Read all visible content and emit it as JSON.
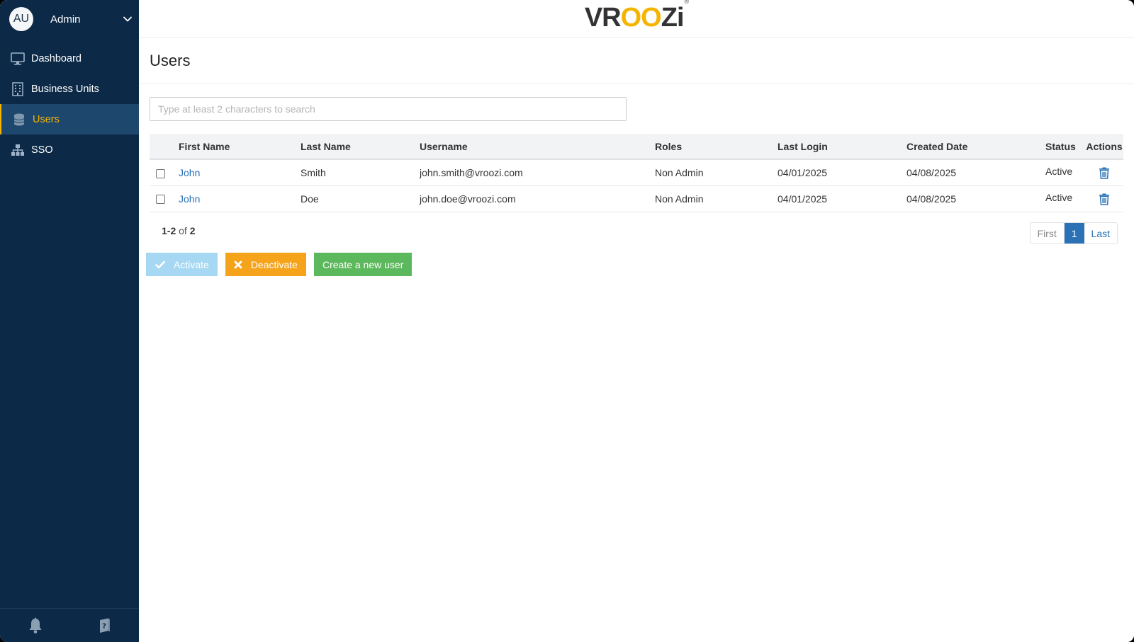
{
  "user": {
    "initials": "AU",
    "name": "Admin"
  },
  "nav": {
    "items": [
      {
        "label": "Dashboard",
        "icon": "monitor-icon"
      },
      {
        "label": "Business Units",
        "icon": "building-icon"
      },
      {
        "label": "Users",
        "icon": "database-icon",
        "active": true
      },
      {
        "label": "SSO",
        "icon": "sitemap-icon"
      }
    ]
  },
  "brand": {
    "logo_a": "VR",
    "logo_b": "OO",
    "logo_c": "Zi",
    "reg": "®"
  },
  "page": {
    "title": "Users"
  },
  "search": {
    "placeholder": "Type at least 2 characters to search"
  },
  "table": {
    "headers": {
      "first": "First Name",
      "last": "Last Name",
      "user": "Username",
      "roles": "Roles",
      "login": "Last Login",
      "created": "Created Date",
      "status": "Status",
      "actions": "Actions"
    },
    "rows": [
      {
        "first": "John",
        "last": "Smith",
        "user": "john.smith@vroozi.com",
        "roles": "Non Admin",
        "login": "04/01/2025",
        "created": "04/08/2025",
        "status": "Active"
      },
      {
        "first": "John",
        "last": "Doe",
        "user": "john.doe@vroozi.com",
        "roles": "Non Admin",
        "login": "04/01/2025",
        "created": "04/08/2025",
        "status": "Active"
      }
    ]
  },
  "pagination": {
    "range": "1-2",
    "of": "of",
    "total": "2",
    "first": "First",
    "current": "1",
    "last": "Last"
  },
  "buttons": {
    "activate": "Activate",
    "deactivate": "Deactivate",
    "create": "Create a new user"
  },
  "colors": {
    "sidebar_bg": "#0c2a47",
    "active_nav_bg": "#1e476e",
    "accent_yellow": "#f5b400",
    "link_blue": "#2a72b5",
    "activate_bg": "#a6d8f3",
    "deactivate_bg": "#f5a31a",
    "create_bg": "#5cb85c"
  }
}
